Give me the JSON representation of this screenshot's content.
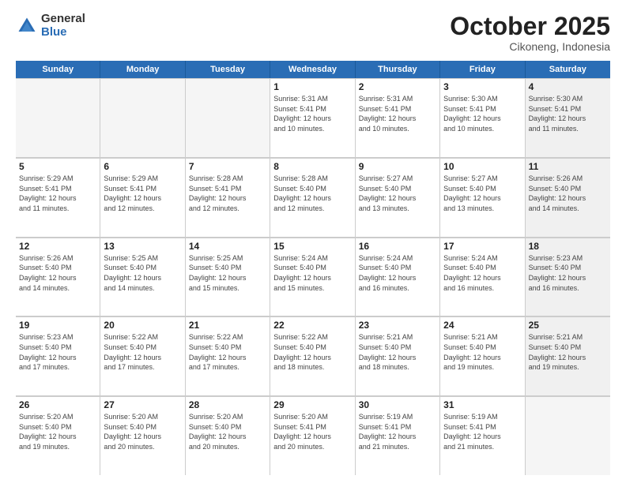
{
  "logo": {
    "general": "General",
    "blue": "Blue"
  },
  "header": {
    "month": "October 2025",
    "location": "Cikoneng, Indonesia"
  },
  "weekdays": [
    "Sunday",
    "Monday",
    "Tuesday",
    "Wednesday",
    "Thursday",
    "Friday",
    "Saturday"
  ],
  "weeks": [
    [
      {
        "day": "",
        "info": "",
        "empty": true
      },
      {
        "day": "",
        "info": "",
        "empty": true
      },
      {
        "day": "",
        "info": "",
        "empty": true
      },
      {
        "day": "1",
        "info": "Sunrise: 5:31 AM\nSunset: 5:41 PM\nDaylight: 12 hours\nand 10 minutes."
      },
      {
        "day": "2",
        "info": "Sunrise: 5:31 AM\nSunset: 5:41 PM\nDaylight: 12 hours\nand 10 minutes."
      },
      {
        "day": "3",
        "info": "Sunrise: 5:30 AM\nSunset: 5:41 PM\nDaylight: 12 hours\nand 10 minutes."
      },
      {
        "day": "4",
        "info": "Sunrise: 5:30 AM\nSunset: 5:41 PM\nDaylight: 12 hours\nand 11 minutes.",
        "shaded": true
      }
    ],
    [
      {
        "day": "5",
        "info": "Sunrise: 5:29 AM\nSunset: 5:41 PM\nDaylight: 12 hours\nand 11 minutes."
      },
      {
        "day": "6",
        "info": "Sunrise: 5:29 AM\nSunset: 5:41 PM\nDaylight: 12 hours\nand 12 minutes."
      },
      {
        "day": "7",
        "info": "Sunrise: 5:28 AM\nSunset: 5:41 PM\nDaylight: 12 hours\nand 12 minutes."
      },
      {
        "day": "8",
        "info": "Sunrise: 5:28 AM\nSunset: 5:40 PM\nDaylight: 12 hours\nand 12 minutes."
      },
      {
        "day": "9",
        "info": "Sunrise: 5:27 AM\nSunset: 5:40 PM\nDaylight: 12 hours\nand 13 minutes."
      },
      {
        "day": "10",
        "info": "Sunrise: 5:27 AM\nSunset: 5:40 PM\nDaylight: 12 hours\nand 13 minutes."
      },
      {
        "day": "11",
        "info": "Sunrise: 5:26 AM\nSunset: 5:40 PM\nDaylight: 12 hours\nand 14 minutes.",
        "shaded": true
      }
    ],
    [
      {
        "day": "12",
        "info": "Sunrise: 5:26 AM\nSunset: 5:40 PM\nDaylight: 12 hours\nand 14 minutes."
      },
      {
        "day": "13",
        "info": "Sunrise: 5:25 AM\nSunset: 5:40 PM\nDaylight: 12 hours\nand 14 minutes."
      },
      {
        "day": "14",
        "info": "Sunrise: 5:25 AM\nSunset: 5:40 PM\nDaylight: 12 hours\nand 15 minutes."
      },
      {
        "day": "15",
        "info": "Sunrise: 5:24 AM\nSunset: 5:40 PM\nDaylight: 12 hours\nand 15 minutes."
      },
      {
        "day": "16",
        "info": "Sunrise: 5:24 AM\nSunset: 5:40 PM\nDaylight: 12 hours\nand 16 minutes."
      },
      {
        "day": "17",
        "info": "Sunrise: 5:24 AM\nSunset: 5:40 PM\nDaylight: 12 hours\nand 16 minutes."
      },
      {
        "day": "18",
        "info": "Sunrise: 5:23 AM\nSunset: 5:40 PM\nDaylight: 12 hours\nand 16 minutes.",
        "shaded": true
      }
    ],
    [
      {
        "day": "19",
        "info": "Sunrise: 5:23 AM\nSunset: 5:40 PM\nDaylight: 12 hours\nand 17 minutes."
      },
      {
        "day": "20",
        "info": "Sunrise: 5:22 AM\nSunset: 5:40 PM\nDaylight: 12 hours\nand 17 minutes."
      },
      {
        "day": "21",
        "info": "Sunrise: 5:22 AM\nSunset: 5:40 PM\nDaylight: 12 hours\nand 17 minutes."
      },
      {
        "day": "22",
        "info": "Sunrise: 5:22 AM\nSunset: 5:40 PM\nDaylight: 12 hours\nand 18 minutes."
      },
      {
        "day": "23",
        "info": "Sunrise: 5:21 AM\nSunset: 5:40 PM\nDaylight: 12 hours\nand 18 minutes."
      },
      {
        "day": "24",
        "info": "Sunrise: 5:21 AM\nSunset: 5:40 PM\nDaylight: 12 hours\nand 19 minutes."
      },
      {
        "day": "25",
        "info": "Sunrise: 5:21 AM\nSunset: 5:40 PM\nDaylight: 12 hours\nand 19 minutes.",
        "shaded": true
      }
    ],
    [
      {
        "day": "26",
        "info": "Sunrise: 5:20 AM\nSunset: 5:40 PM\nDaylight: 12 hours\nand 19 minutes."
      },
      {
        "day": "27",
        "info": "Sunrise: 5:20 AM\nSunset: 5:40 PM\nDaylight: 12 hours\nand 20 minutes."
      },
      {
        "day": "28",
        "info": "Sunrise: 5:20 AM\nSunset: 5:40 PM\nDaylight: 12 hours\nand 20 minutes."
      },
      {
        "day": "29",
        "info": "Sunrise: 5:20 AM\nSunset: 5:41 PM\nDaylight: 12 hours\nand 20 minutes."
      },
      {
        "day": "30",
        "info": "Sunrise: 5:19 AM\nSunset: 5:41 PM\nDaylight: 12 hours\nand 21 minutes."
      },
      {
        "day": "31",
        "info": "Sunrise: 5:19 AM\nSunset: 5:41 PM\nDaylight: 12 hours\nand 21 minutes."
      },
      {
        "day": "",
        "info": "",
        "empty": true,
        "shaded": true
      }
    ]
  ]
}
